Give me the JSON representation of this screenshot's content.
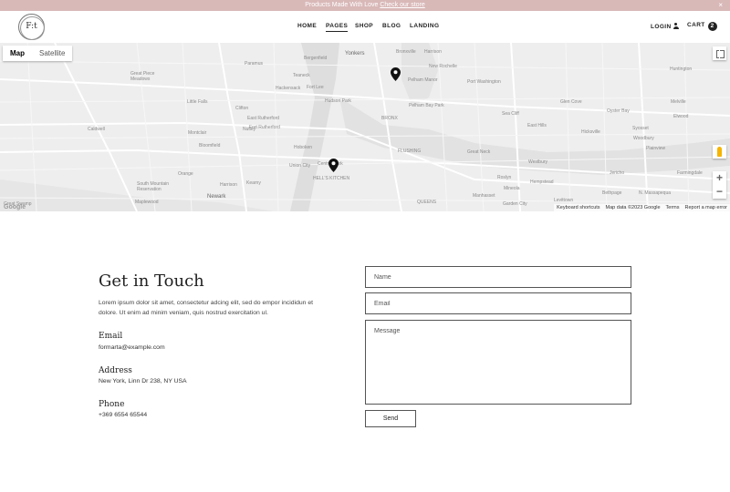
{
  "announcement": {
    "text": "Products Made With Love",
    "link": "Check our store",
    "close": "×"
  },
  "header": {
    "logo_text": "F:t",
    "nav": [
      "HOME",
      "PAGES",
      "SHOP",
      "BLOG",
      "LANDING"
    ],
    "active_nav": "PAGES",
    "login_label": "LOGIN",
    "cart_label": "CART",
    "cart_count": "2"
  },
  "map": {
    "toggle": {
      "map": "Map",
      "satellite": "Satellite"
    },
    "footer": {
      "shortcuts": "Keyboard shortcuts",
      "data": "Map data ©2023 Google",
      "terms": "Terms",
      "report": "Report a map error"
    },
    "google_logo": "Google",
    "labels": {
      "yonkers": "Yonkers",
      "bronxville": "Bronxville",
      "pelham_manor": "Pelham Manor",
      "pelham_bay_park": "Pelham Bay Park",
      "great_neck": "Great Neck",
      "port_washington": "Port Washington",
      "glen_cove": "Glen Cove",
      "sea_cliff": "Sea Cliff",
      "roslyn": "Roslyn",
      "manhasset": "Manhasset",
      "mineola": "Mineola",
      "westbury": "Westbury",
      "hicksville": "Hicksville",
      "garden_city": "Garden City",
      "hempstead": "Hempstead",
      "bloomfield": "Bloomfield",
      "montclair": "Montclair",
      "newark": "Newark",
      "hoboken": "Hoboken",
      "union_city": "Union City",
      "fort_lee": "Fort Lee",
      "hackensack": "Hackensack",
      "teaneck": "Teaneck",
      "paramus": "Paramus",
      "little_falls": "Little Falls",
      "clifton": "Clifton",
      "nutley": "Nutley",
      "kearny": "Kearny",
      "harrison": "Harrison",
      "hudson_park": "Hudson Park",
      "flushing": "FLUSHING",
      "queens": "QUEENS",
      "bronx": "BRONX",
      "hells_kitchen": "HELL'S KITCHEN",
      "central_park": "Central Park",
      "great_piece_meadows": "Great Piece Meadows",
      "south_mountain": "South Mountain Reservation",
      "maplewood": "Maplewood",
      "orange": "Orange",
      "caldwell": "Caldwell",
      "great_swamp": "Great Swamp",
      "east_rutherford": "East Rutherford",
      "fort_rutherford": "Fort Rutherford",
      "bergenfield": "Bergenfield",
      "new_rochelle": "New Rochelle",
      "harrison_ny": "Harrison",
      "east_hills": "East Hills",
      "jericho": "Jericho",
      "oyster_bay": "Oyster Bay",
      "syosset": "Syosset",
      "huntington": "Huntington",
      "elwood": "Elwood",
      "plainview": "Plainview",
      "north_massapequa": "N. Massapequa",
      "woodbury": "Woodbury",
      "levittown": "Levittown",
      "bethpage": "Bethpage",
      "farmingdale": "Farmingdale",
      "melville": "Melville"
    }
  },
  "contact": {
    "title": "Get in Touch",
    "text": "Lorem ipsum dolor sit amet, consectetur adcing elit, sed do empor incididun et dolore. Ut enim ad minim veniam, quis nostrud exercitation ul.",
    "email_label": "Email",
    "email_value": "formarta@example.com",
    "address_label": "Address",
    "address_value": "New York, Linn Dr 238, NY USA",
    "phone_label": "Phone",
    "phone_value": "+369 6554 65544"
  },
  "form": {
    "name_placeholder": "Name",
    "email_placeholder": "Email",
    "message_placeholder": "Message",
    "send_label": "Send"
  }
}
